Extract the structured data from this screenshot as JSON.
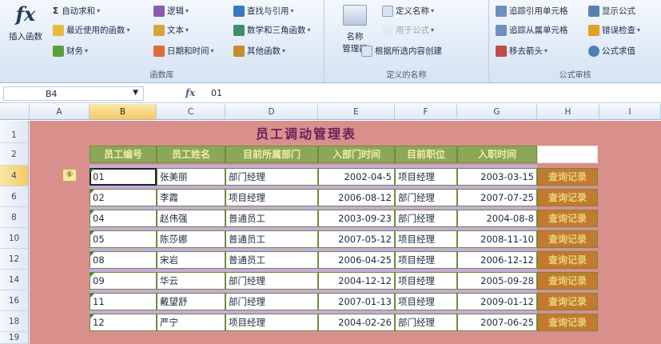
{
  "ribbon": {
    "insert_function": "插入函数",
    "library": {
      "label": "函数库",
      "autosum": "自动求和",
      "recent": "最近使用的函数",
      "financial": "财务",
      "logical": "逻辑",
      "text": "文本",
      "datetime": "日期和时间",
      "lookup": "查找与引用",
      "math": "数学和三角函数",
      "more": "其他函数"
    },
    "names": {
      "label": "定义的名称",
      "name_manager_1": "名称",
      "name_manager_2": "管理器",
      "define_name": "定义名称",
      "use_in_formula": "用于公式",
      "create_from_selection": "根据所选内容创建"
    },
    "audit": {
      "label": "公式审核",
      "trace_precedents": "追踪引用单元格",
      "trace_dependents": "追踪从属单元格",
      "remove_arrows": "移去箭头",
      "show_formulas": "显示公式",
      "error_checking": "错误检查",
      "evaluate_formula": "公式求值"
    }
  },
  "formula_bar": {
    "name_box": "B4",
    "fx": "fx",
    "content": "01"
  },
  "columns": [
    "A",
    "B",
    "C",
    "D",
    "E",
    "F",
    "G",
    "H",
    "I"
  ],
  "rows": [
    "1",
    "2",
    "4",
    "6",
    "8",
    "10",
    "12",
    "14",
    "16",
    "18",
    "19"
  ],
  "sheet": {
    "title": "员工调动管理表",
    "headers": [
      "员工编号",
      "员工姓名",
      "目前所属部门",
      "入部门时间",
      "目前职位",
      "入职时间"
    ],
    "badge": "⑧",
    "link_label": "查询记录",
    "records": [
      {
        "id": "01",
        "name": "张美丽",
        "dept": "部门经理",
        "dept_date": "2002-04-5",
        "position": "项目经理",
        "hire_date": "2003-03-15"
      },
      {
        "id": "02",
        "name": "李霞",
        "dept": "项目经理",
        "dept_date": "2006-08-12",
        "position": "部门经理",
        "hire_date": "2007-07-25"
      },
      {
        "id": "04",
        "name": "赵伟强",
        "dept": "普通员工",
        "dept_date": "2003-09-23",
        "position": "部门经理",
        "hire_date": "2004-08-8"
      },
      {
        "id": "05",
        "name": "陈莎娜",
        "dept": "普通员工",
        "dept_date": "2007-05-12",
        "position": "项目经理",
        "hire_date": "2008-11-10"
      },
      {
        "id": "08",
        "name": "宋岩",
        "dept": "普通员工",
        "dept_date": "2006-04-25",
        "position": "项目经理",
        "hire_date": "2006-12-12"
      },
      {
        "id": "09",
        "name": "华云",
        "dept": "部门经理",
        "dept_date": "2004-12-12",
        "position": "项目经理",
        "hire_date": "2005-09-28"
      },
      {
        "id": "11",
        "name": "戴望舒",
        "dept": "部门经理",
        "dept_date": "2007-01-13",
        "position": "项目经理",
        "hire_date": "2009-01-12"
      },
      {
        "id": "12",
        "name": "严宁",
        "dept": "项目经理",
        "dept_date": "2004-02-26",
        "position": "部门经理",
        "hire_date": "2007-06-25"
      }
    ]
  }
}
